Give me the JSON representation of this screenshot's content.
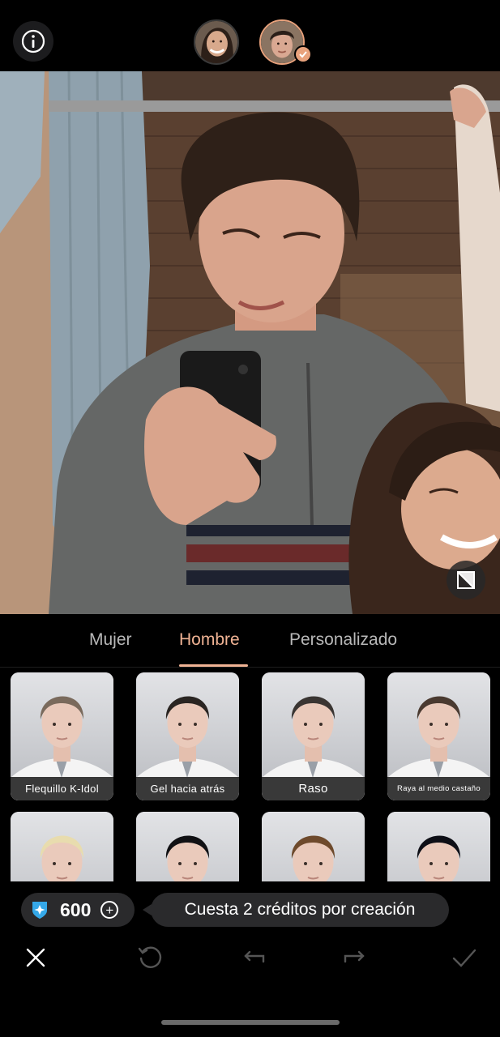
{
  "tabs": [
    {
      "label": "Mujer",
      "active": false
    },
    {
      "label": "Hombre",
      "active": true
    },
    {
      "label": "Personalizado",
      "active": false
    }
  ],
  "styles": [
    {
      "label": "Flequillo K-Idol",
      "hair": "#7a6a5c"
    },
    {
      "label": "Gel hacia atrás",
      "hair": "#2a2522"
    },
    {
      "label": "Raso",
      "hair": "#3a3532"
    },
    {
      "label": "Raya al medio castaño",
      "hair": "#4a3a30"
    },
    {
      "label": "",
      "hair": "#e8dcae"
    },
    {
      "label": "",
      "hair": "#111114"
    },
    {
      "label": "",
      "hair": "#6e4a2c"
    },
    {
      "label": "",
      "hair": "#0e0f16"
    }
  ],
  "credits": {
    "count": "600",
    "plus": "+"
  },
  "cost_text": "Cuesta 2 créditos por creación",
  "icons": {
    "info": "info-icon",
    "compare": "compare-icon",
    "close": "close-icon",
    "reset": "reset-icon",
    "undo": "undo-icon",
    "redo": "redo-icon",
    "confirm": "check-icon",
    "gem": "gem-icon"
  },
  "colors": {
    "accent": "#f0b394",
    "badge": "#e8a27c",
    "gem": "#35a8e8"
  }
}
